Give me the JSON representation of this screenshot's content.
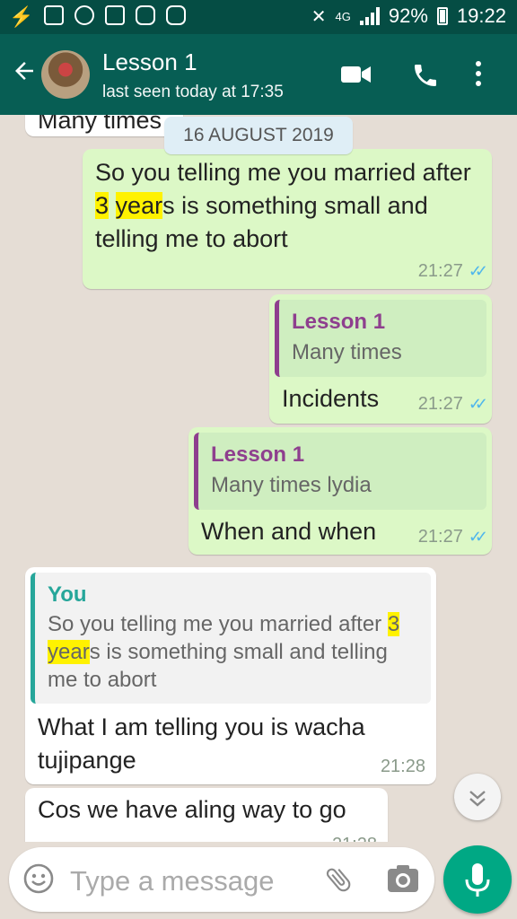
{
  "status": {
    "network": "4G",
    "battery": "92%",
    "time": "19:22"
  },
  "header": {
    "contact_name": "Lesson 1",
    "last_seen": "last seen today at 17:35"
  },
  "date_chip": "16 AUGUST 2019",
  "messages": [
    {
      "partial_text": "Many times"
    },
    {
      "text_parts": [
        "So you telling me  you married after ",
        "3",
        " ",
        "year",
        "s is something small and telling me to abort"
      ],
      "time": "21:27"
    },
    {
      "quote_name": "Lesson 1",
      "quote_text": "Many times",
      "text": "Incidents",
      "time": "21:27"
    },
    {
      "quote_name": "Lesson 1",
      "quote_text": "Many times lydia",
      "text": "When and when",
      "time": "21:27"
    },
    {
      "quote_name": "You",
      "quote_parts": [
        "So you telling me  you married after ",
        "3",
        " ",
        "year",
        "s is something small and telling me to abort"
      ],
      "text": "What I am telling you is wacha tujipange",
      "time": "21:28"
    },
    {
      "text": "Cos we have aling way to go",
      "partial_time": "21:28"
    }
  ],
  "input": {
    "placeholder": "Type a message"
  },
  "colors": {
    "header": "#075e54",
    "statusbar": "#054d44",
    "outgoing": "#dcf8c6",
    "incoming": "#ffffff",
    "accent": "#00a884",
    "highlight": "#fff200"
  },
  "icons": [
    "back-arrow-icon",
    "video-call-icon",
    "phone-icon",
    "more-options-icon",
    "emoji-icon",
    "attach-icon",
    "camera-icon",
    "mic-icon",
    "scroll-down-icon",
    "double-check-icon"
  ]
}
